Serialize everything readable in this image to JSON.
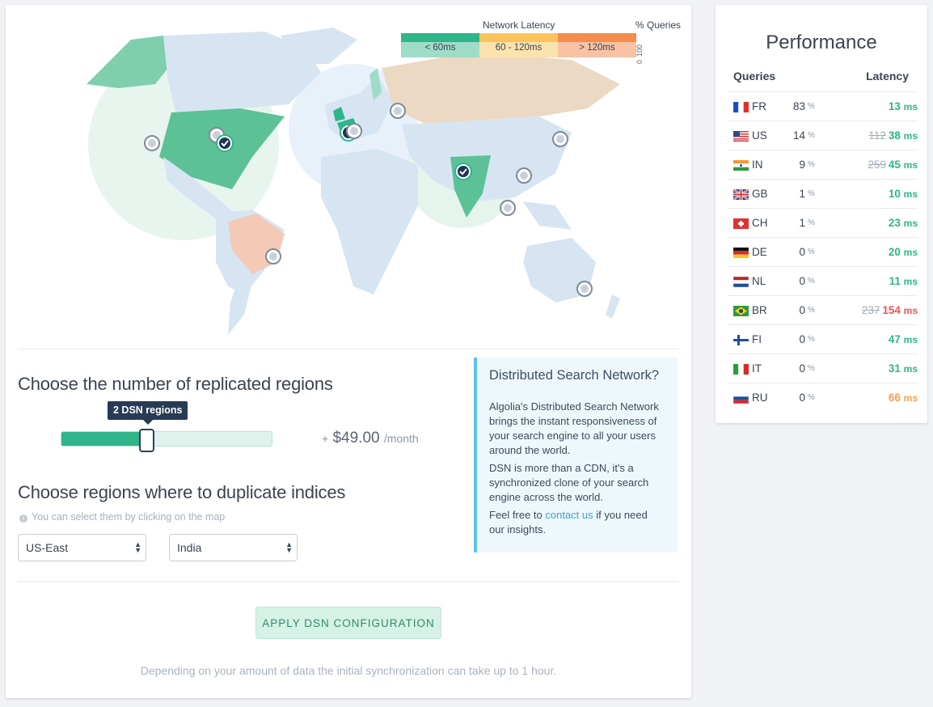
{
  "legend": {
    "title": "Network Latency",
    "queries_label": "% Queries",
    "axis_top": "100",
    "axis_bottom": "0",
    "buckets": [
      {
        "label": "< 60ms",
        "color": "#2fb58a",
        "light": "#9fdcc8"
      },
      {
        "label": "60 - 120ms",
        "color": "#fbc45a",
        "light": "#fbe3ad"
      },
      {
        "label": "> 120ms",
        "color": "#f58b4c",
        "light": "#f8c3a4"
      }
    ]
  },
  "replicas": {
    "heading": "Choose the number of replicated regions",
    "tooltip": "2 DSN regions",
    "price_prefix": "+",
    "price": "$49.00",
    "price_suffix": "/month",
    "slider_fill_fraction": 0.4
  },
  "regions": {
    "heading": "Choose regions where to duplicate indices",
    "hint": "You can select them by clicking on the map",
    "selects": [
      "US-East",
      "India"
    ]
  },
  "apply_label": "APPLY DSN CONFIGURATION",
  "sync_note": "Depending on your amount of data the initial synchronization can take up to 1 hour.",
  "dsn_box": {
    "title": "Distributed Search Network?",
    "p1": "Algolia's Distributed Search Network brings the instant responsiveness of your search engine to all your users around the world.",
    "p2": "DSN is more than a CDN, it's a synchronized clone of your search engine across the world.",
    "p3_before": "Feel free to ",
    "p3_link": "contact us",
    "p3_after": " if you need our insights."
  },
  "performance": {
    "title": "Performance",
    "col_queries": "Queries",
    "col_latency": "Latency",
    "percent_sign": "%",
    "ms_unit": "ms",
    "rows": [
      {
        "cc": "FR",
        "q": "83",
        "old": "",
        "lat": "13",
        "color": "#2fb58a"
      },
      {
        "cc": "US",
        "q": "14",
        "old": "112",
        "lat": "38",
        "color": "#2fb58a"
      },
      {
        "cc": "IN",
        "q": "9",
        "old": "259",
        "lat": "45",
        "color": "#2fb58a"
      },
      {
        "cc": "GB",
        "q": "1",
        "old": "",
        "lat": "10",
        "color": "#2fb58a"
      },
      {
        "cc": "CH",
        "q": "1",
        "old": "",
        "lat": "23",
        "color": "#2fb58a"
      },
      {
        "cc": "DE",
        "q": "0",
        "old": "",
        "lat": "20",
        "color": "#2fb58a"
      },
      {
        "cc": "NL",
        "q": "0",
        "old": "",
        "lat": "11",
        "color": "#2fb58a"
      },
      {
        "cc": "BR",
        "q": "0",
        "old": "237",
        "lat": "154",
        "color": "#ef5350"
      },
      {
        "cc": "FI",
        "q": "0",
        "old": "",
        "lat": "47",
        "color": "#2fb58a"
      },
      {
        "cc": "IT",
        "q": "0",
        "old": "",
        "lat": "31",
        "color": "#2fb58a"
      },
      {
        "cc": "RU",
        "q": "0",
        "old": "",
        "lat": "66",
        "color": "#f5a04c"
      }
    ]
  }
}
